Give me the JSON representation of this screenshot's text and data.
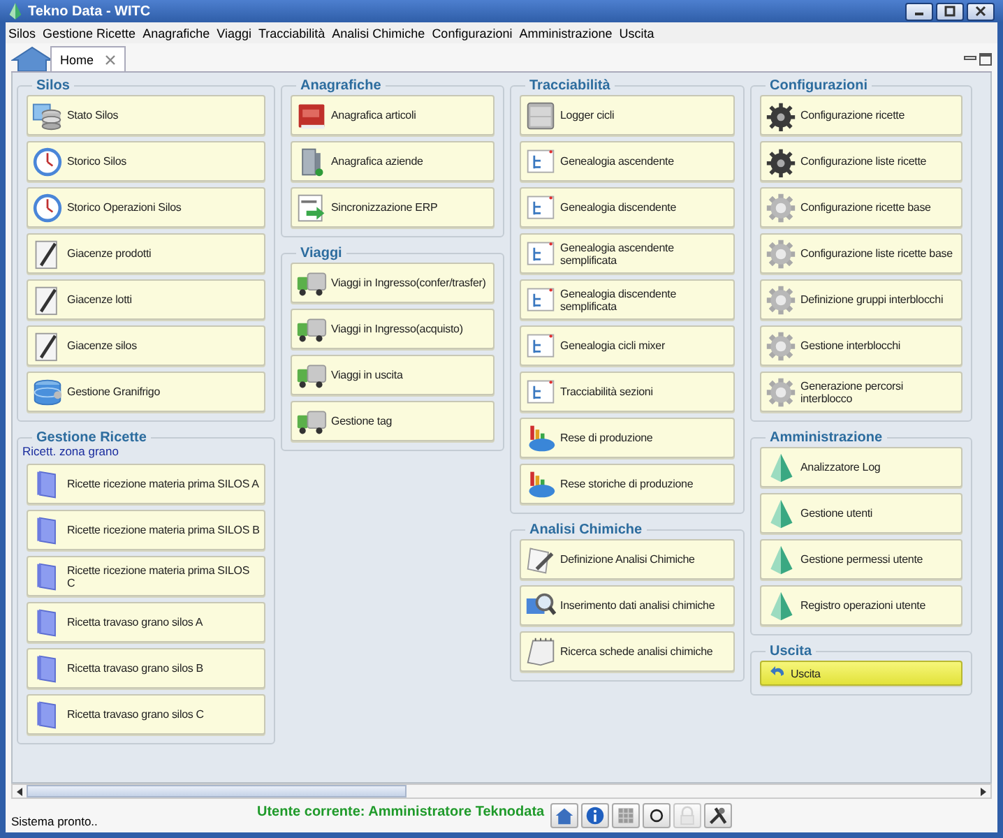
{
  "window": {
    "title": "Tekno Data - WITC"
  },
  "menu": [
    "Silos",
    "Gestione Ricette",
    "Anagrafiche",
    "Viaggi",
    "Tracciabilità",
    "Analisi Chimiche",
    "Configurazioni",
    "Amministrazione",
    "Uscita"
  ],
  "tabs": [
    {
      "label": "Home",
      "selected": true
    }
  ],
  "columns": [
    {
      "groups": [
        {
          "title": "Silos",
          "items": [
            {
              "label": "Stato Silos",
              "kind": "silos"
            },
            {
              "label": "Storico Silos",
              "kind": "clock"
            },
            {
              "label": "Storico Operazioni Silos",
              "kind": "clock"
            },
            {
              "label": "Giacenze prodotti",
              "kind": "pencil"
            },
            {
              "label": "Giacenze lotti",
              "kind": "pencil"
            },
            {
              "label": "Giacenze silos",
              "kind": "pencil"
            },
            {
              "label": "Gestione Granifrigo",
              "kind": "database"
            }
          ]
        },
        {
          "title": "Gestione Ricette",
          "subtitle": "Ricett. zona grano",
          "items": [
            {
              "label": "Ricette ricezione materia prima SILOS A",
              "kind": "binder"
            },
            {
              "label": "Ricette ricezione materia prima SILOS B",
              "kind": "binder"
            },
            {
              "label": "Ricette ricezione materia prima SILOS C",
              "kind": "binder"
            },
            {
              "label": "Ricetta travaso grano silos A",
              "kind": "binder"
            },
            {
              "label": "Ricetta travaso grano silos B",
              "kind": "binder"
            },
            {
              "label": "Ricetta travaso grano silos C",
              "kind": "binder"
            }
          ]
        }
      ]
    },
    {
      "groups": [
        {
          "title": "Anagrafiche",
          "items": [
            {
              "label": "Anagrafica articoli",
              "kind": "book"
            },
            {
              "label": "Anagrafica aziende",
              "kind": "building"
            },
            {
              "label": "Sincronizzazione ERP",
              "kind": "sync"
            }
          ]
        },
        {
          "title": "Viaggi",
          "items": [
            {
              "label": "Viaggi in Ingresso(confer/trasfer)",
              "kind": "truck"
            },
            {
              "label": "Viaggi in Ingresso(acquisto)",
              "kind": "truck"
            },
            {
              "label": "Viaggi in uscita",
              "kind": "truck"
            },
            {
              "label": "Gestione tag",
              "kind": "truck"
            }
          ]
        }
      ]
    },
    {
      "groups": [
        {
          "title": "Tracciabilità",
          "items": [
            {
              "label": "Logger cicli",
              "kind": "drawer"
            },
            {
              "label": "Genealogia ascendente",
              "kind": "tree"
            },
            {
              "label": "Genealogia discendente",
              "kind": "tree"
            },
            {
              "label": "Genealogia ascendente semplificata",
              "kind": "tree"
            },
            {
              "label": "Genealogia discendente semplificata",
              "kind": "tree"
            },
            {
              "label": "Genealogia cicli mixer",
              "kind": "tree"
            },
            {
              "label": "Tracciabilità sezioni",
              "kind": "tree"
            },
            {
              "label": "Rese di produzione",
              "kind": "chart"
            },
            {
              "label": "Rese storiche di produzione",
              "kind": "chart"
            }
          ]
        },
        {
          "title": "Analisi Chimiche",
          "items": [
            {
              "label": "Definizione Analisi Chimiche",
              "kind": "docpen"
            },
            {
              "label": "Inserimento dati analisi chimiche",
              "kind": "magnifier"
            },
            {
              "label": "Ricerca schede analisi chimiche",
              "kind": "notepad"
            }
          ]
        }
      ]
    },
    {
      "groups": [
        {
          "title": "Configurazioni",
          "items": [
            {
              "label": "Configurazione ricette",
              "kind": "gears"
            },
            {
              "label": "Configurazione liste ricette",
              "kind": "gears"
            },
            {
              "label": "Configurazione ricette base",
              "kind": "gear"
            },
            {
              "label": "Configurazione liste ricette base",
              "kind": "gear"
            },
            {
              "label": "Definizione gruppi interblocchi",
              "kind": "gear"
            },
            {
              "label": "Gestione interblocchi",
              "kind": "gear"
            },
            {
              "label": "Generazione percorsi interblocco",
              "kind": "gear"
            }
          ]
        },
        {
          "title": "Amministrazione",
          "items": [
            {
              "label": "Analizzatore Log",
              "kind": "pyramid"
            },
            {
              "label": "Gestione utenti",
              "kind": "pyramid"
            },
            {
              "label": "Gestione permessi utente",
              "kind": "pyramid"
            },
            {
              "label": "Registro operazioni utente",
              "kind": "pyramid"
            }
          ]
        },
        {
          "title": "Uscita",
          "items": [
            {
              "label": "Uscita",
              "kind": "exit"
            }
          ]
        }
      ]
    }
  ],
  "status_bar": {
    "message": "Sistema pronto..",
    "user": "Utente corrente: Amministratore Teknodata",
    "tools": [
      {
        "kind": "home",
        "disabled": false
      },
      {
        "kind": "info",
        "disabled": false
      },
      {
        "kind": "grid",
        "disabled": false
      },
      {
        "kind": "circle",
        "disabled": false
      },
      {
        "kind": "lock",
        "disabled": true
      },
      {
        "kind": "tools",
        "disabled": false
      }
    ]
  }
}
